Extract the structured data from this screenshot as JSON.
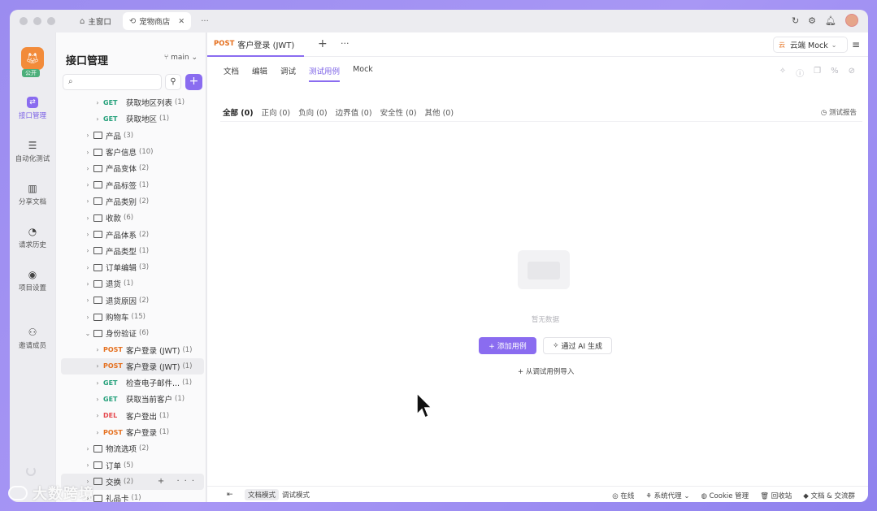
{
  "window_tabs": [
    {
      "label": "主窗口",
      "icon": "home-icon"
    },
    {
      "label": "宠物商店",
      "icon": "link-icon"
    }
  ],
  "rail": {
    "logo_badge": "公开",
    "items": [
      {
        "label": "接口管理",
        "icon": "api-icon"
      },
      {
        "label": "自动化测试",
        "icon": "automation-icon"
      },
      {
        "label": "分享文档",
        "icon": "book-icon"
      },
      {
        "label": "请求历史",
        "icon": "clock-icon"
      },
      {
        "label": "项目设置",
        "icon": "settings-icon"
      },
      {
        "label": "邀请成员",
        "icon": "invite-icon"
      }
    ]
  },
  "sidebar": {
    "title": "接口管理",
    "branch": "main",
    "search_placeholder": "",
    "tree": [
      {
        "indent": 2,
        "method": "GET",
        "name": "获取地区列表",
        "count": "(1)"
      },
      {
        "indent": 2,
        "method": "GET",
        "name": "获取地区",
        "count": "(1)"
      },
      {
        "indent": 1,
        "folder": true,
        "name": "产品",
        "count": "(3)"
      },
      {
        "indent": 1,
        "folder": true,
        "name": "客户信息",
        "count": "(10)"
      },
      {
        "indent": 1,
        "folder": true,
        "name": "产品变体",
        "count": "(2)"
      },
      {
        "indent": 1,
        "folder": true,
        "name": "产品标签",
        "count": "(1)"
      },
      {
        "indent": 1,
        "folder": true,
        "name": "产品类别",
        "count": "(2)"
      },
      {
        "indent": 1,
        "folder": true,
        "name": "收款",
        "count": "(6)"
      },
      {
        "indent": 1,
        "folder": true,
        "name": "产品体系",
        "count": "(2)"
      },
      {
        "indent": 1,
        "folder": true,
        "name": "产品类型",
        "count": "(1)"
      },
      {
        "indent": 1,
        "folder": true,
        "name": "订单编辑",
        "count": "(3)"
      },
      {
        "indent": 1,
        "folder": true,
        "name": "退货",
        "count": "(1)"
      },
      {
        "indent": 1,
        "folder": true,
        "name": "退货原因",
        "count": "(2)"
      },
      {
        "indent": 1,
        "folder": true,
        "name": "购物车",
        "count": "(15)"
      },
      {
        "indent": 1,
        "folder": true,
        "open": true,
        "name": "身份验证",
        "count": "(6)"
      },
      {
        "indent": 2,
        "method": "POST",
        "name": "客户登录 (JWT)",
        "count": "(1)"
      },
      {
        "indent": 2,
        "method": "POST",
        "name": "客户登录 (JWT)",
        "count": "(1)",
        "selected": true
      },
      {
        "indent": 2,
        "method": "GET",
        "name": "检查电子邮件...",
        "count": "(1)"
      },
      {
        "indent": 2,
        "method": "GET",
        "name": "获取当前客户",
        "count": "(1)"
      },
      {
        "indent": 2,
        "method": "DEL",
        "name": "客户登出",
        "count": "(1)"
      },
      {
        "indent": 2,
        "method": "POST",
        "name": "客户登录",
        "count": "(1)"
      },
      {
        "indent": 1,
        "folder": true,
        "name": "物流选项",
        "count": "(2)"
      },
      {
        "indent": 1,
        "folder": true,
        "name": "订单",
        "count": "(5)"
      },
      {
        "indent": 1,
        "folder": true,
        "name": "交换",
        "count": "(2)",
        "hover": true
      },
      {
        "indent": 1,
        "folder": true,
        "name": "礼品卡",
        "count": "(1)"
      }
    ]
  },
  "main": {
    "doc_tab": {
      "method": "POST",
      "name": "客户登录 (JWT)"
    },
    "environment": "云端 Mock",
    "environment_badge": "云",
    "subtabs": [
      "文档",
      "编辑",
      "调试",
      "测试用例",
      "Mock"
    ],
    "active_subtab": "测试用例",
    "filters": [
      "全部 (0)",
      "正向 (0)",
      "负向 (0)",
      "边界值 (0)",
      "安全性 (0)",
      "其他 (0)"
    ],
    "report_label": "测试报告",
    "empty_text": "暂无数据",
    "add_case_label": "+ 添加用例",
    "ai_generate_label": "通过 AI 生成",
    "import_label": "+ 从调试用例导入"
  },
  "footer": {
    "doc_mode": "文档模式",
    "debug_mode": "调试模式",
    "online": "在线",
    "proxy": "系统代理",
    "cookie": "Cookie 管理",
    "recycle": "回收站",
    "docs_community": "文档 & 交流群"
  },
  "watermark": "大数跨境",
  "colors": {
    "accent": "#8a6cf0",
    "get": "#24a07a",
    "post": "#e5701f",
    "delete": "#e5484d"
  }
}
